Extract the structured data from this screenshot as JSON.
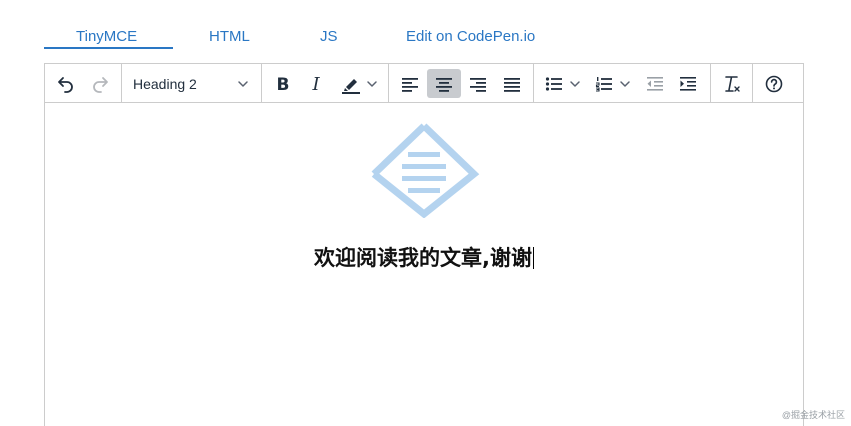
{
  "tabs": [
    {
      "label": "TinyMCE",
      "active": true
    },
    {
      "label": "HTML",
      "active": false
    },
    {
      "label": "JS",
      "active": false
    },
    {
      "label": "Edit on CodePen.io",
      "active": false
    }
  ],
  "toolbar": {
    "undo_icon": "undo-icon",
    "redo_icon": "redo-icon",
    "block_format": "Heading 2",
    "bold_icon": "bold-icon",
    "italic_icon": "italic-icon",
    "highlight_icon": "highlight-color-icon",
    "align_left_icon": "align-left-icon",
    "align_center_icon": "align-center-icon",
    "align_right_icon": "align-right-icon",
    "align_justify_icon": "align-justify-icon",
    "bullet_list_icon": "bullet-list-icon",
    "numbered_list_icon": "numbered-list-icon",
    "outdent_icon": "outdent-icon",
    "indent_icon": "indent-icon",
    "remove_format_icon": "remove-format-icon",
    "help_icon": "help-icon",
    "active_alignment": "center"
  },
  "content": {
    "heading": "欢迎阅读我的文章,谢谢"
  },
  "watermark": "@掘金技术社区",
  "colors": {
    "tab_accent": "#2a77c4",
    "logo": "#b4d3ef",
    "active_button": "#c8cbcf",
    "border": "#cccccc"
  }
}
